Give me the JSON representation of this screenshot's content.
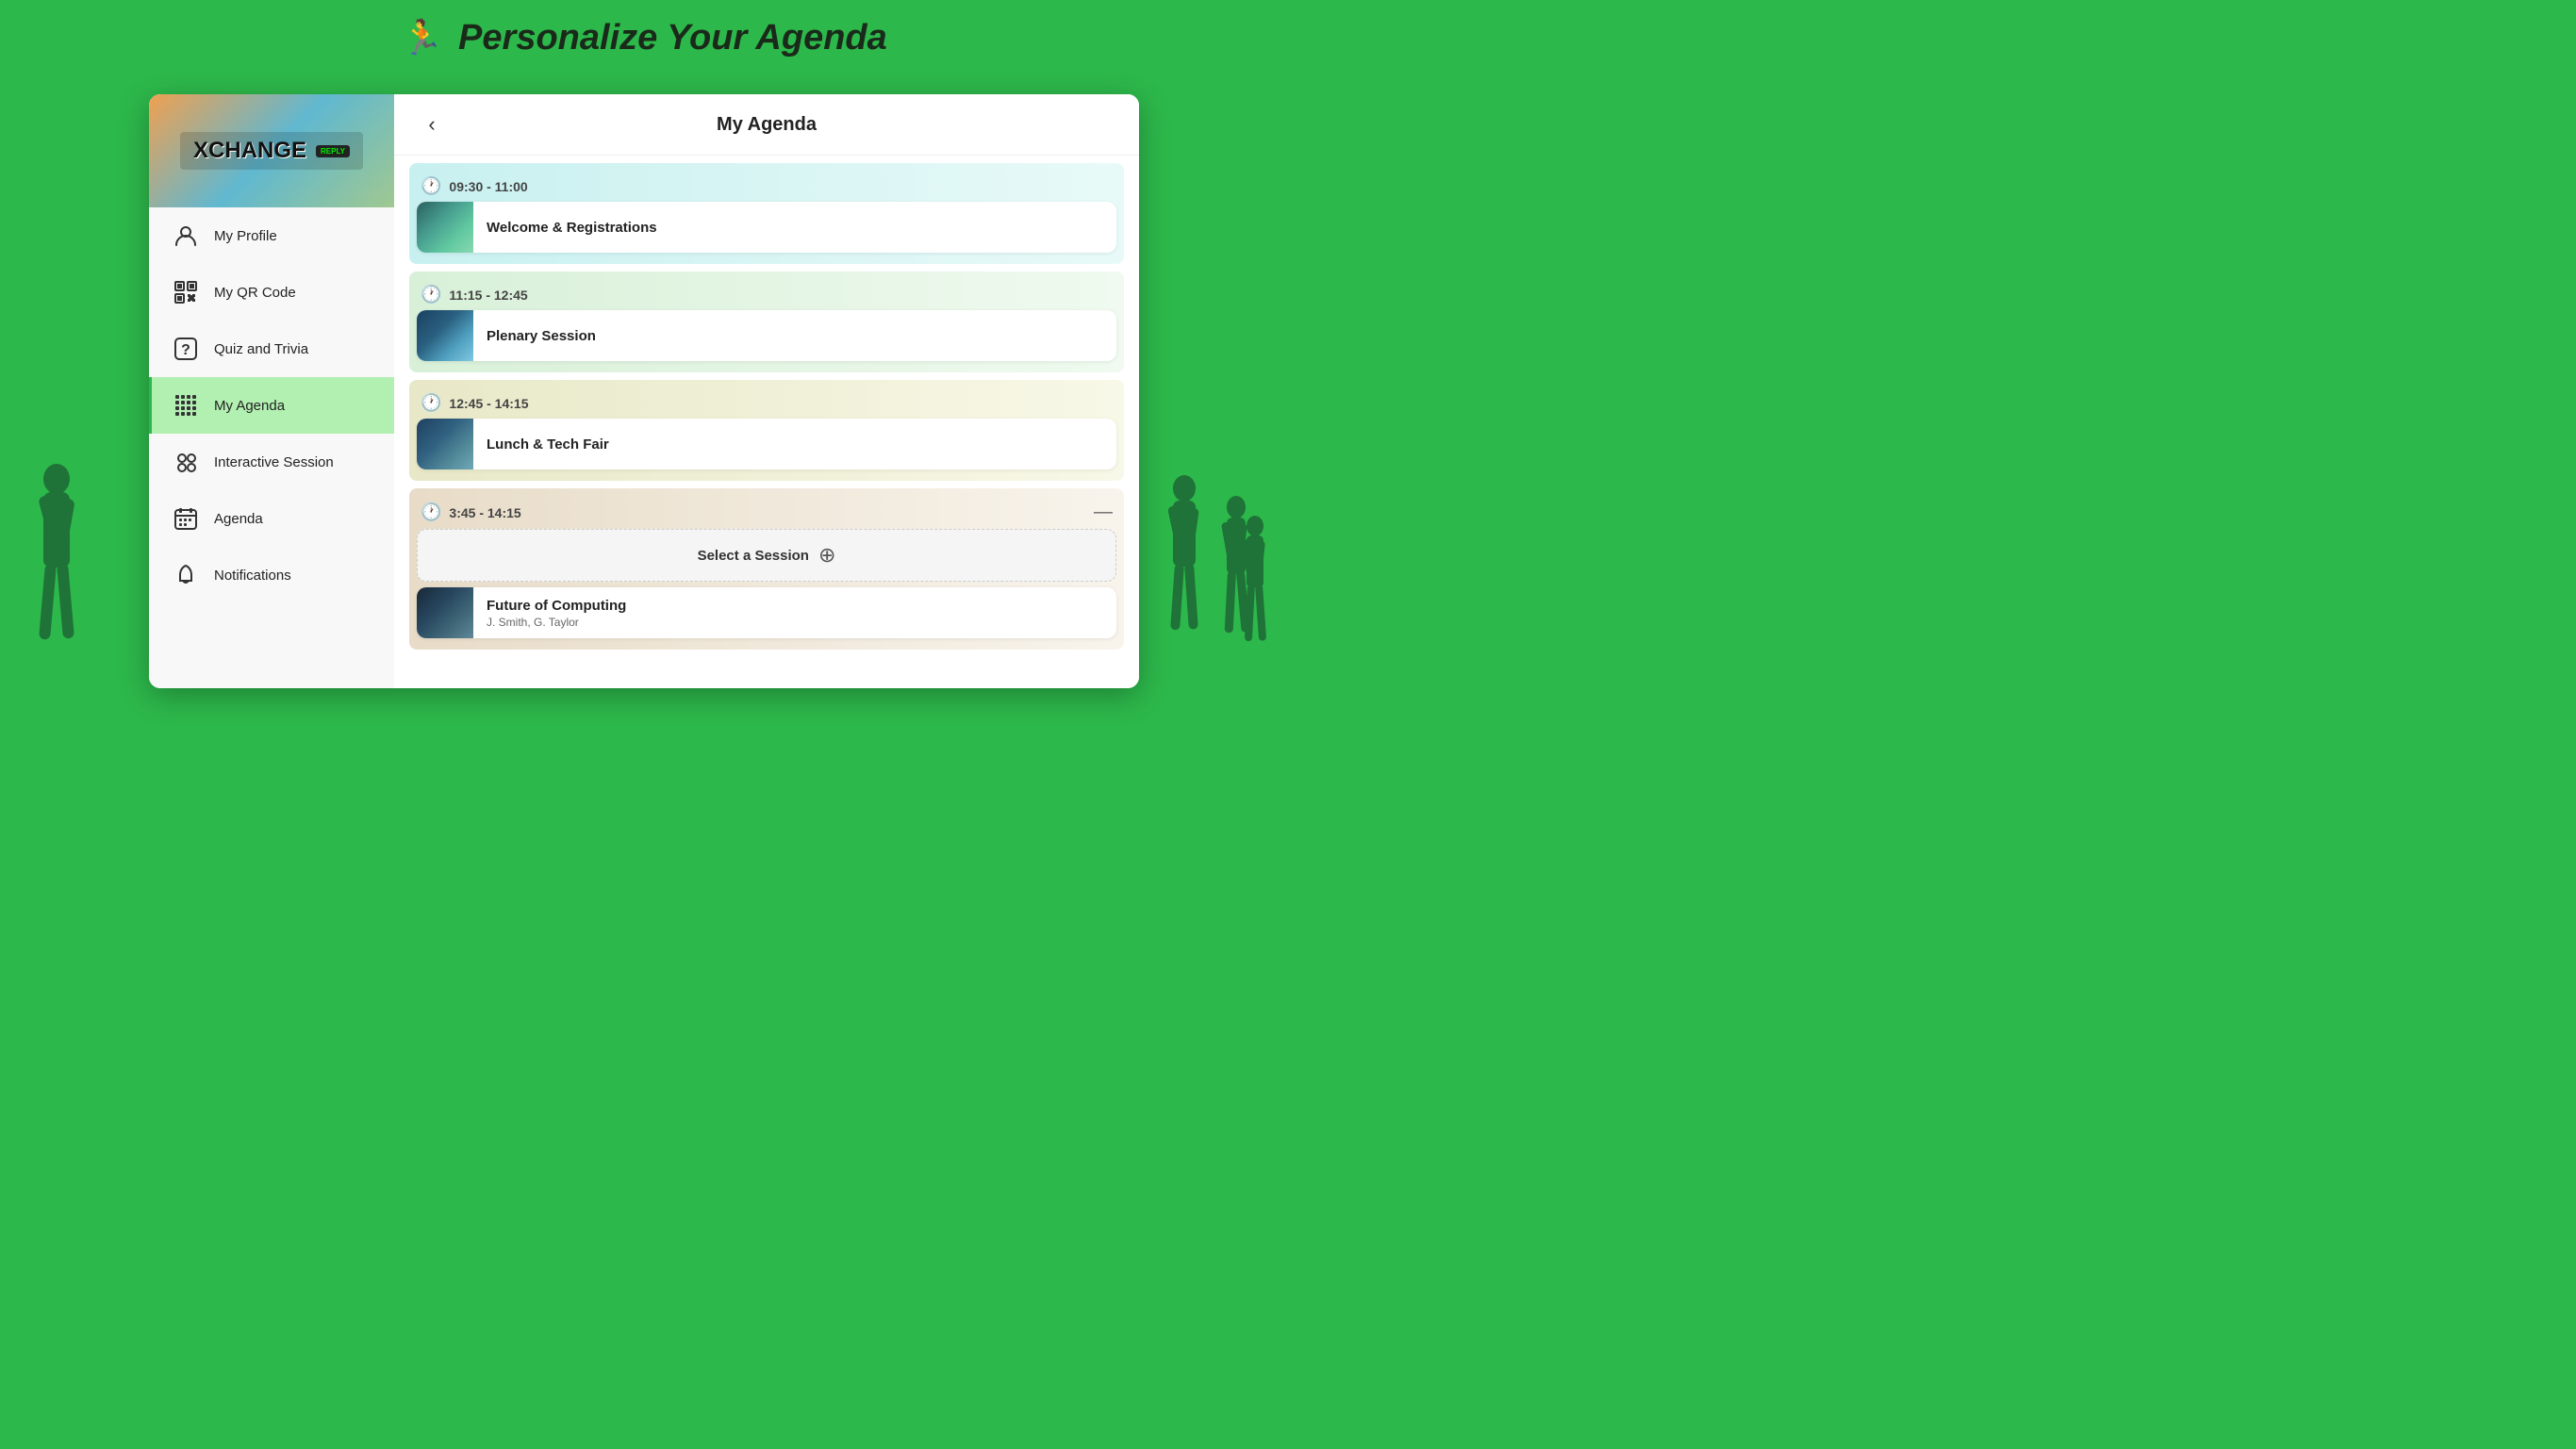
{
  "header": {
    "title_prefix": "Personalize Your ",
    "title_accent": "Agenda",
    "icon": "🏃"
  },
  "sidebar": {
    "logo": {
      "name": "XCHANGE",
      "badge": "REPLY"
    },
    "nav_items": [
      {
        "id": "my-profile",
        "label": "My Profile",
        "icon": "person",
        "active": false
      },
      {
        "id": "my-qr-code",
        "label": "My QR Code",
        "icon": "qr",
        "active": false
      },
      {
        "id": "quiz-and-trivia",
        "label": "Quiz and Trivia",
        "icon": "question",
        "active": false
      },
      {
        "id": "my-agenda",
        "label": "My Agenda",
        "icon": "grid",
        "active": true
      },
      {
        "id": "interactive-session",
        "label": "Interactive Session",
        "icon": "circles",
        "active": false
      },
      {
        "id": "agenda",
        "label": "Agenda",
        "icon": "grid2",
        "active": false
      },
      {
        "id": "notifications",
        "label": "Notifications",
        "icon": "bell",
        "active": false
      }
    ]
  },
  "content": {
    "title": "My Agenda",
    "time_blocks": [
      {
        "id": "block-1",
        "time": "09:30 - 11:00",
        "color": "cyan",
        "sessions": [
          {
            "id": "s1",
            "title": "Welcome & Registrations",
            "subtitle": "",
            "thumb_class": "thumb-1"
          }
        ]
      },
      {
        "id": "block-2",
        "time": "11:15 - 12:45",
        "color": "green",
        "sessions": [
          {
            "id": "s2",
            "title": "Plenary Session",
            "subtitle": "",
            "thumb_class": "thumb-2"
          }
        ]
      },
      {
        "id": "block-3",
        "time": "12:45 - 14:15",
        "color": "olive",
        "sessions": [
          {
            "id": "s3",
            "title": "Lunch & Tech Fair",
            "subtitle": "",
            "thumb_class": "thumb-3"
          }
        ]
      },
      {
        "id": "block-4",
        "time": "3:45 - 14:15",
        "color": "tan",
        "has_select": true,
        "sessions": [
          {
            "id": "s5",
            "title": "Future of Computing",
            "subtitle": "J. Smith, G. Taylor",
            "thumb_class": "thumb-5"
          }
        ]
      }
    ],
    "select_session_label": "Select a Session"
  }
}
